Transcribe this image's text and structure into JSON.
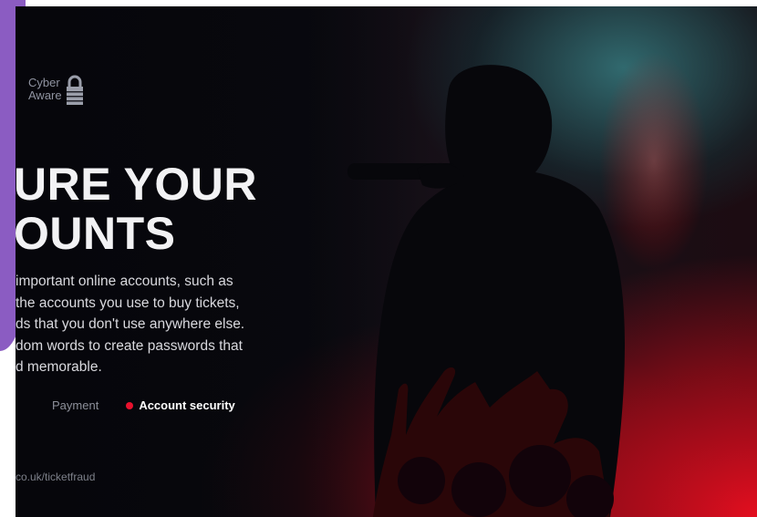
{
  "brand": {
    "logo_text": "Cyber\nAware"
  },
  "headline": {
    "line1": "URE YOUR",
    "line2": "OUNTS"
  },
  "body": {
    "lines": [
      "important online accounts, such as",
      "the accounts you use to buy tickets,",
      "ds that you don't use anywhere else.",
      "dom words to create passwords that",
      "d memorable."
    ]
  },
  "tabs": [
    {
      "label": "Payment",
      "active": false
    },
    {
      "label": "Account security",
      "active": true
    }
  ],
  "footer": {
    "url": "co.uk/ticketfraud"
  },
  "colors": {
    "accent_red": "#e8112d",
    "purple": "#8b5cc2",
    "headline": "#f2f2f4",
    "body_text": "#d9d9de"
  },
  "icons": {
    "logo": "lock-icon",
    "active_marker": "red-dot"
  }
}
